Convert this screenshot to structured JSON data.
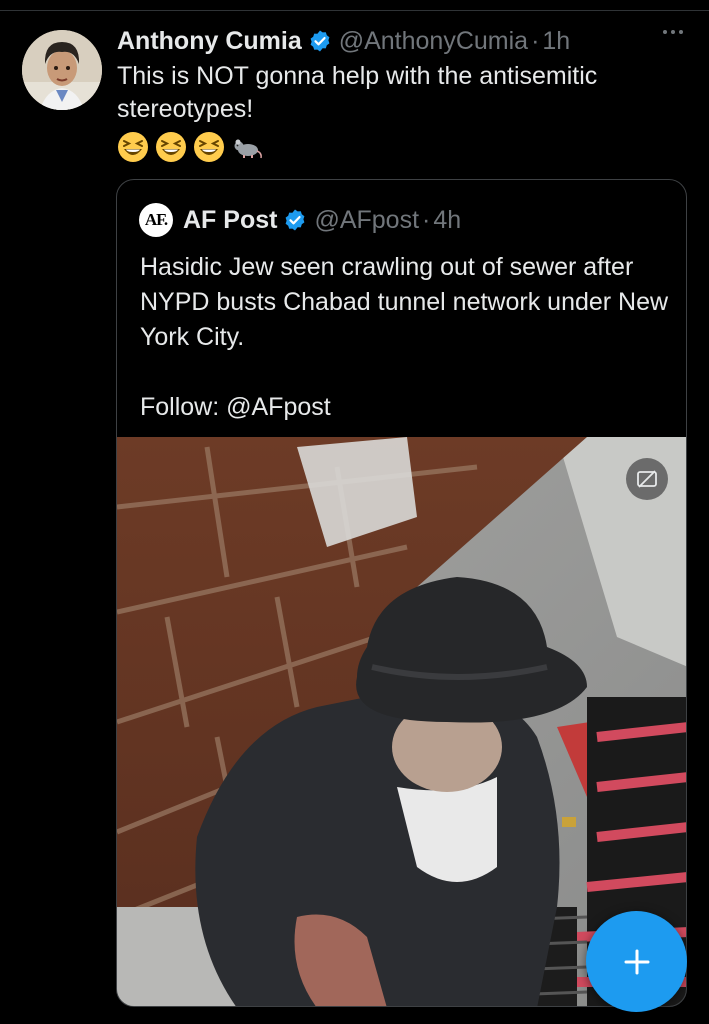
{
  "tweet": {
    "author_name": "Anthony Cumia",
    "handle": "@AnthonyCumia",
    "separator": "·",
    "time": "1h",
    "text": "This is NOT gonna help with the antisemitic stereotypes!",
    "emojis": [
      "grinning-squinting-face",
      "grinning-squinting-face",
      "grinning-squinting-face",
      "rat"
    ]
  },
  "quote": {
    "logo_text": "AF.",
    "author_name": "AF Post",
    "handle": "@AFpost",
    "separator": "·",
    "time": "4h",
    "text_line1": "Hasidic Jew seen crawling out of sewer after NYPD busts Chabad tunnel network under New York City.",
    "text_line2": "Follow: @AFpost"
  },
  "colors": {
    "background": "#000000",
    "text_primary": "#e7e9ea",
    "text_secondary": "#71767b",
    "verified_blue": "#1d9bf0",
    "accent": "#1d9bf0",
    "border": "#3e4144"
  },
  "icons": {
    "verified": "verified-badge-icon",
    "more": "more-options-icon",
    "gif": "gif-icon",
    "compose": "plus-icon"
  }
}
